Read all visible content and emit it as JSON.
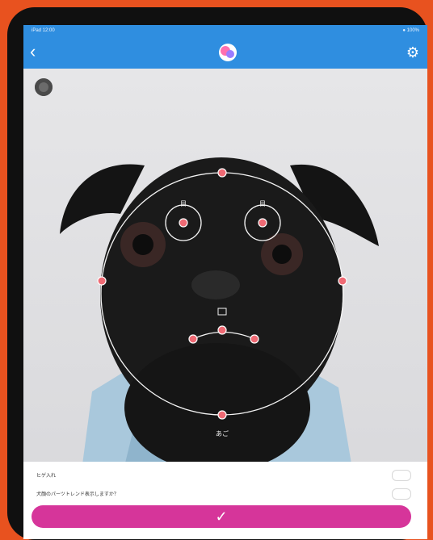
{
  "status": {
    "left": "iPad 12:00",
    "right": "● 100%"
  },
  "nav": {
    "back_icon": "‹",
    "settings_icon": "⚙"
  },
  "landmarks": {
    "eye_left_label": "目",
    "eye_right_label": "目",
    "chin_label": "あご"
  },
  "options": {
    "item1": "ヒゲ入れ",
    "item2": "犬顔のパーツトレンド表示しますか？"
  },
  "confirm_icon": "✓",
  "colors": {
    "accent": "#d6359a",
    "nav": "#2f8ee0",
    "point": "#ef6a74"
  }
}
